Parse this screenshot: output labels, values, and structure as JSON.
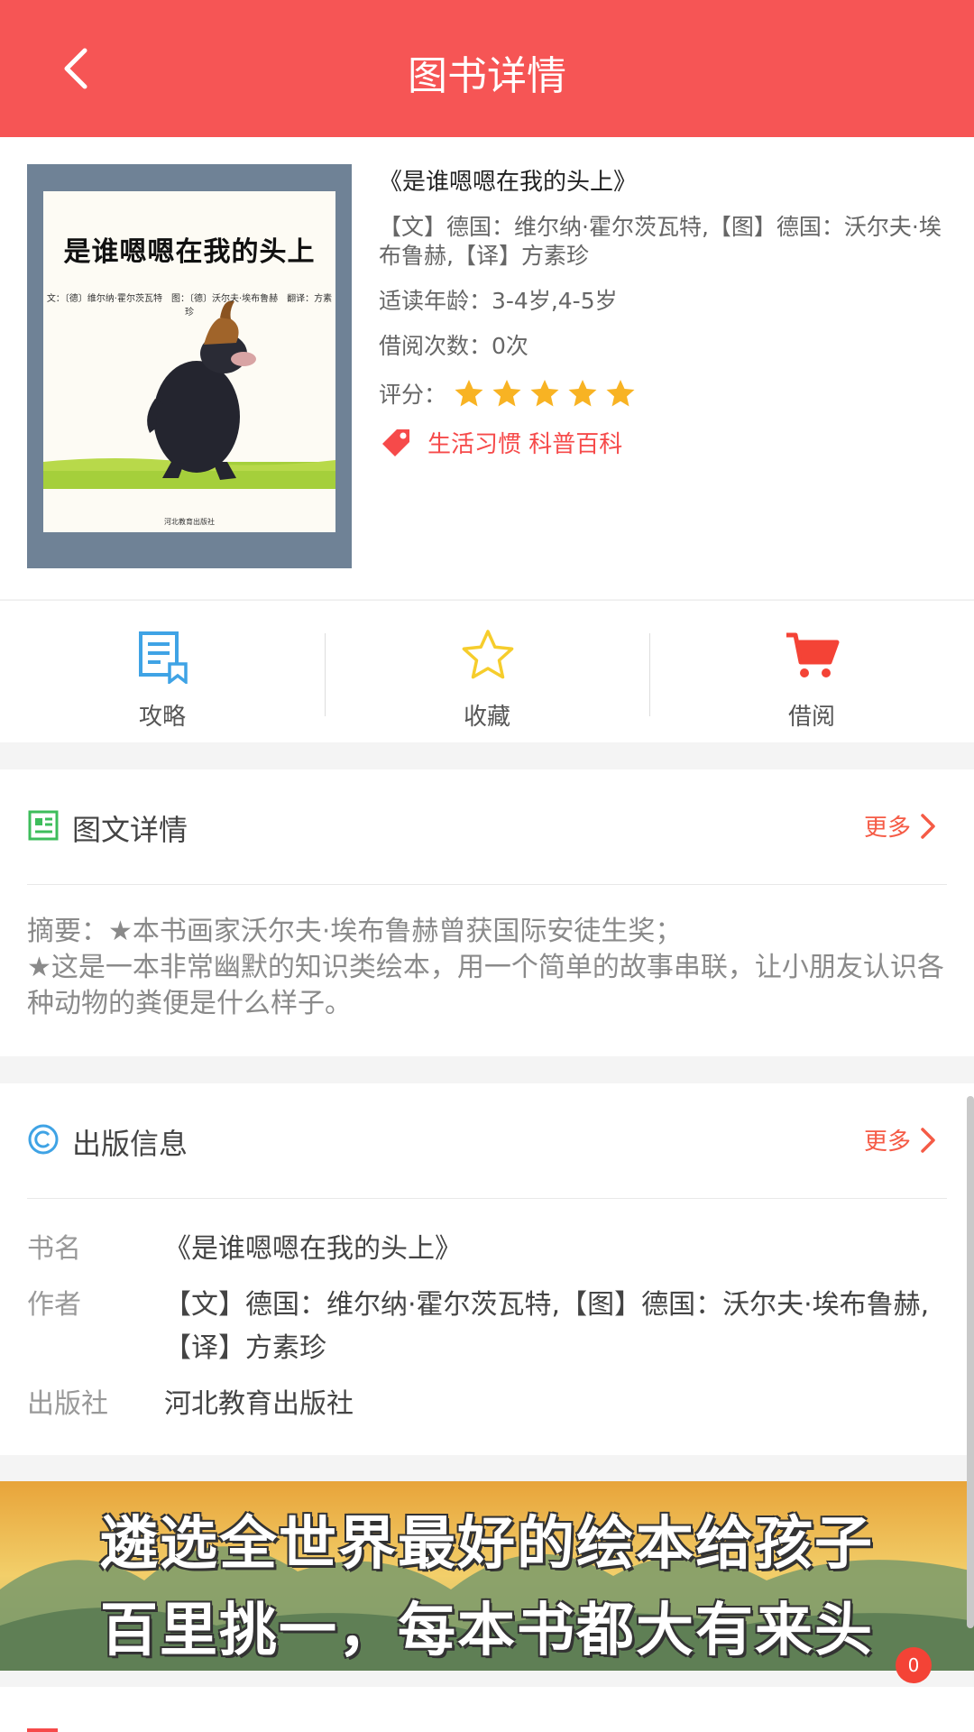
{
  "header": {
    "title": "图书详情",
    "back_icon": "chevron-left-icon"
  },
  "book": {
    "cover": {
      "title": "是谁嗯嗯在我的头上",
      "credits": "文：〔德〕维尔纳·霍尔茨瓦特　图：〔德〕沃尔夫·埃布鲁赫　翻译：方素珍",
      "publisher_mark": "河北教育出版社"
    },
    "name": "《是谁嗯嗯在我的头上》",
    "author": "【文】德国：维尔纳·霍尔茨瓦特,【图】德国：沃尔夫·埃布鲁赫,【译】方素珍",
    "age": "适读年龄：3-4岁,4-5岁",
    "borrow_count": "借阅次数：0次",
    "rating_label": "评分：",
    "rating": 5,
    "tags": "生活习惯 科普百科",
    "tag_icon": "price-tag-icon"
  },
  "actions": [
    {
      "label": "攻略",
      "icon": "article-icon",
      "color": "#3fa3e5"
    },
    {
      "label": "收藏",
      "icon": "star-outline-icon",
      "color": "#f6cd2c"
    },
    {
      "label": "借阅",
      "icon": "cart-icon",
      "color": "#f44336"
    }
  ],
  "detail_section": {
    "title": "图文详情",
    "icon": "picture-text-icon",
    "more": "更多",
    "summary": "摘要：★本书画家沃尔夫·埃布鲁赫曾获国际安徒生奖；\n★这是一本非常幽默的知识类绘本，用一个简单的故事串联，让小朋友认识各种动物的粪便是什么样子。"
  },
  "publish_section": {
    "title": "出版信息",
    "icon": "copyright-icon",
    "more": "更多",
    "rows": [
      {
        "key": "书名",
        "value": "《是谁嗯嗯在我的头上》"
      },
      {
        "key": "作者",
        "value": "【文】德国：维尔纳·霍尔茨瓦特,【图】德国：沃尔夫·埃布鲁赫,【译】方素珍"
      },
      {
        "key": "出版社",
        "value": "河北教育出版社"
      }
    ]
  },
  "banner": {
    "line1": "遴选全世界最好的绘本给孩子",
    "line2": "百里挑一，每本书都大有来头"
  },
  "badge_count": "0",
  "colors": {
    "header": "#f65555",
    "accent": "#f64a4a",
    "star": "#f8b323",
    "more": "#f55b46"
  }
}
